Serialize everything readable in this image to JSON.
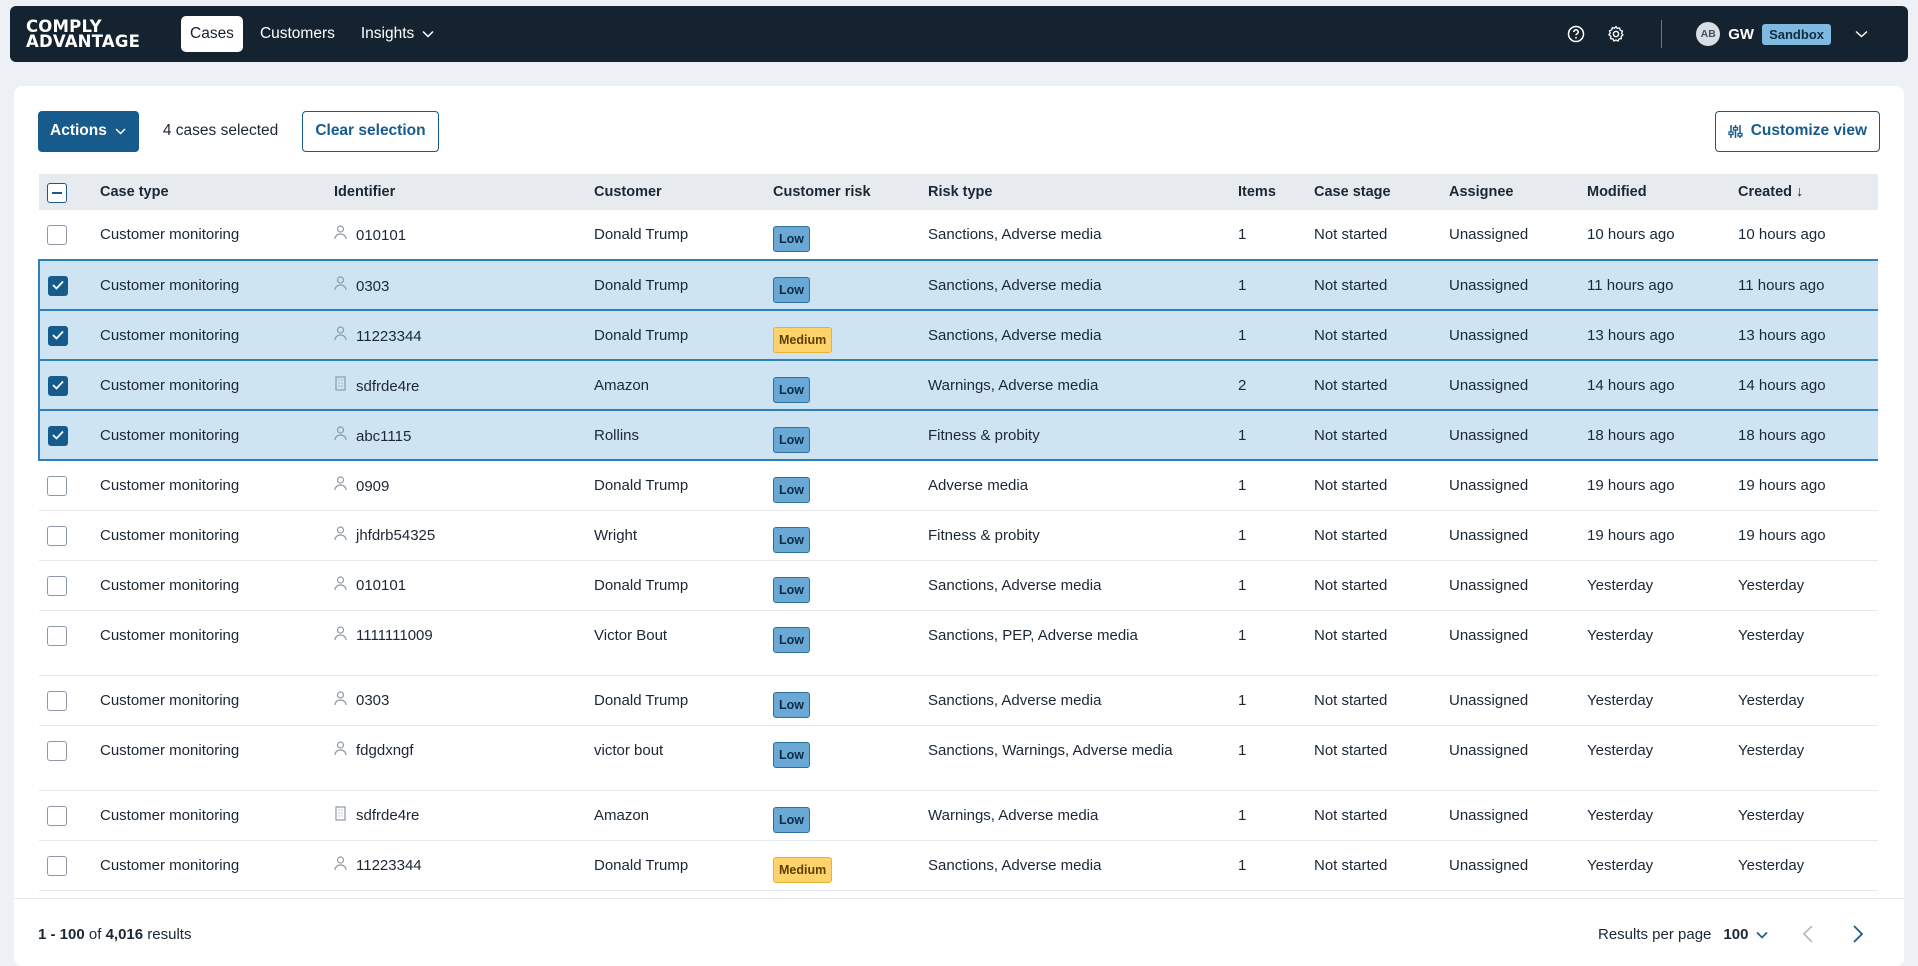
{
  "app": {
    "logo_line1": "COMPLY",
    "logo_line2": "ADVANTAGE"
  },
  "nav": {
    "items": [
      {
        "label": "Cases",
        "active": true
      },
      {
        "label": "Customers",
        "active": false
      },
      {
        "label": "Insights",
        "active": false,
        "has_dropdown": true
      }
    ]
  },
  "user": {
    "avatar_initials": "AB",
    "initials": "GW",
    "environment": "Sandbox"
  },
  "toolbar": {
    "actions_label": "Actions",
    "selection_text": "4 cases selected",
    "clear_label": "Clear selection",
    "customize_label": "Customize view"
  },
  "table": {
    "columns": [
      "Case type",
      "Identifier",
      "Customer",
      "Customer risk",
      "Risk type",
      "Items",
      "Case stage",
      "Assignee",
      "Modified",
      "Created"
    ],
    "sort_indicator": "↓",
    "rows": [
      {
        "selected": false,
        "case_type": "Customer monitoring",
        "id_icon": "person-icon",
        "identifier": "010101",
        "customer": "Donald Trump",
        "risk": "Low",
        "risk_type": "Sanctions, Adverse media",
        "items": "1",
        "stage": "Not started",
        "assignee": "Unassigned",
        "modified": "10 hours ago",
        "created": "10 hours ago"
      },
      {
        "selected": true,
        "case_type": "Customer monitoring",
        "id_icon": "person-icon",
        "identifier": "0303",
        "customer": "Donald Trump",
        "risk": "Low",
        "risk_type": "Sanctions, Adverse media",
        "items": "1",
        "stage": "Not started",
        "assignee": "Unassigned",
        "modified": "11 hours ago",
        "created": "11 hours ago"
      },
      {
        "selected": true,
        "case_type": "Customer monitoring",
        "id_icon": "person-icon",
        "identifier": "11223344",
        "customer": "Donald Trump",
        "risk": "Medium",
        "risk_type": "Sanctions, Adverse media",
        "items": "1",
        "stage": "Not started",
        "assignee": "Unassigned",
        "modified": "13 hours ago",
        "created": "13 hours ago"
      },
      {
        "selected": true,
        "case_type": "Customer monitoring",
        "id_icon": "building-icon",
        "identifier": "sdfrde4re",
        "customer": "Amazon",
        "risk": "Low",
        "risk_type": "Warnings, Adverse media",
        "items": "2",
        "stage": "Not started",
        "assignee": "Unassigned",
        "modified": "14 hours ago",
        "created": "14 hours ago"
      },
      {
        "selected": true,
        "case_type": "Customer monitoring",
        "id_icon": "person-icon",
        "identifier": "abc1115",
        "customer": "Rollins",
        "risk": "Low",
        "risk_type": "Fitness & probity",
        "items": "1",
        "stage": "Not started",
        "assignee": "Unassigned",
        "modified": "18 hours ago",
        "created": "18 hours ago"
      },
      {
        "selected": false,
        "case_type": "Customer monitoring",
        "id_icon": "person-icon",
        "identifier": "0909",
        "customer": "Donald Trump",
        "risk": "Low",
        "risk_type": "Adverse media",
        "items": "1",
        "stage": "Not started",
        "assignee": "Unassigned",
        "modified": "19 hours ago",
        "created": "19 hours ago"
      },
      {
        "selected": false,
        "case_type": "Customer monitoring",
        "id_icon": "person-icon",
        "identifier": "jhfdrb54325",
        "customer": "Wright",
        "risk": "Low",
        "risk_type": "Fitness & probity",
        "items": "1",
        "stage": "Not started",
        "assignee": "Unassigned",
        "modified": "19 hours ago",
        "created": "19 hours ago"
      },
      {
        "selected": false,
        "case_type": "Customer monitoring",
        "id_icon": "person-icon",
        "identifier": "010101",
        "customer": "Donald Trump",
        "risk": "Low",
        "risk_type": "Sanctions, Adverse media",
        "items": "1",
        "stage": "Not started",
        "assignee": "Unassigned",
        "modified": "Yesterday",
        "created": "Yesterday"
      },
      {
        "selected": false,
        "case_type": "Customer monitoring",
        "id_icon": "person-icon",
        "identifier": "1111111009",
        "customer": "Victor Bout",
        "risk": "Low",
        "risk_type": "Sanctions, PEP, Adverse media",
        "items": "1",
        "stage": "Not started",
        "assignee": "Unassigned",
        "modified": "Yesterday",
        "created": "Yesterday",
        "tall": true
      },
      {
        "selected": false,
        "case_type": "Customer monitoring",
        "id_icon": "person-icon",
        "identifier": "0303",
        "customer": "Donald Trump",
        "risk": "Low",
        "risk_type": "Sanctions, Adverse media",
        "items": "1",
        "stage": "Not started",
        "assignee": "Unassigned",
        "modified": "Yesterday",
        "created": "Yesterday"
      },
      {
        "selected": false,
        "case_type": "Customer monitoring",
        "id_icon": "person-icon",
        "identifier": "fdgdxngf",
        "customer": "victor bout",
        "risk": "Low",
        "risk_type": "Sanctions, Warnings, Adverse media",
        "items": "1",
        "stage": "Not started",
        "assignee": "Unassigned",
        "modified": "Yesterday",
        "created": "Yesterday",
        "tall": true
      },
      {
        "selected": false,
        "case_type": "Customer monitoring",
        "id_icon": "building-icon",
        "identifier": "sdfrde4re",
        "customer": "Amazon",
        "risk": "Low",
        "risk_type": "Warnings, Adverse media",
        "items": "1",
        "stage": "Not started",
        "assignee": "Unassigned",
        "modified": "Yesterday",
        "created": "Yesterday"
      },
      {
        "selected": false,
        "case_type": "Customer monitoring",
        "id_icon": "person-icon",
        "identifier": "11223344",
        "customer": "Donald Trump",
        "risk": "Medium",
        "risk_type": "Sanctions, Adverse media",
        "items": "1",
        "stage": "Not started",
        "assignee": "Unassigned",
        "modified": "Yesterday",
        "created": "Yesterday"
      }
    ]
  },
  "footer": {
    "range": "1 - 100",
    "of_text": "of",
    "total": "4,016",
    "results_text": "results",
    "rpp_label": "Results per page",
    "rpp_value": "100"
  },
  "colors": {
    "topbar": "#15222f",
    "primary": "#175b8c",
    "selected_row": "#cfe4f2",
    "risk_low": "#6aa8d6",
    "risk_medium": "#ffd36b",
    "sandbox_badge": "#7fb9e0"
  }
}
